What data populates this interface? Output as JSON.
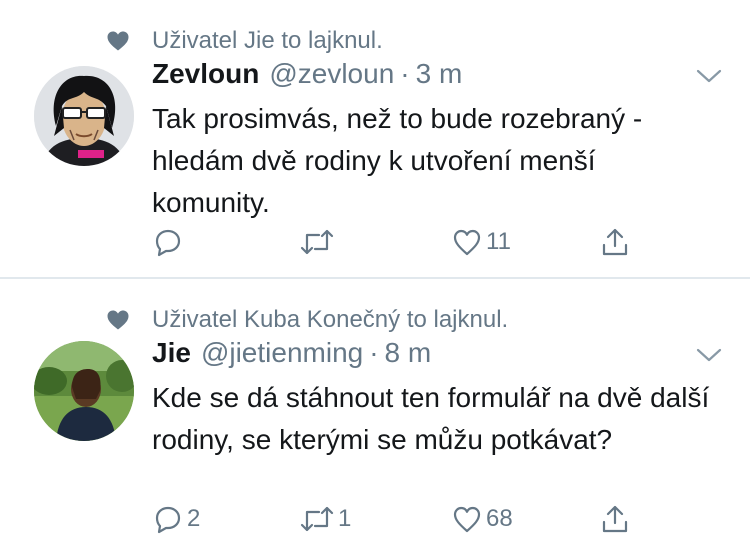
{
  "tweets": [
    {
      "social_context": "Uživatel Jie to lajknul.",
      "icons": {
        "context": "heart-icon",
        "menu": "chevron-down-icon"
      },
      "name": "Zevloun",
      "handle": "@zevloun",
      "separator": "·",
      "time": "3 m",
      "text": "Tak prosimvás, než to bude rozebraný - hledám dvě rodiny k utvoření menší komunity.",
      "actions": {
        "reply": "",
        "retweet": "",
        "like": "11",
        "share": ""
      }
    },
    {
      "social_context": "Uživatel Kuba Konečný to lajknul.",
      "icons": {
        "context": "heart-icon",
        "menu": "chevron-down-icon"
      },
      "name": "Jie",
      "handle": "@jietienming",
      "separator": "·",
      "time": "8 m",
      "text": "Kde se dá stáhnout ten formulář na dvě další rodiny, se kterými se můžu potkávat?",
      "actions": {
        "reply": "2",
        "retweet": "1",
        "like": "68",
        "share": ""
      }
    }
  ],
  "colors": {
    "secondary_text": "#657786",
    "primary_text": "#14171a",
    "divider": "#e1e8ed"
  }
}
